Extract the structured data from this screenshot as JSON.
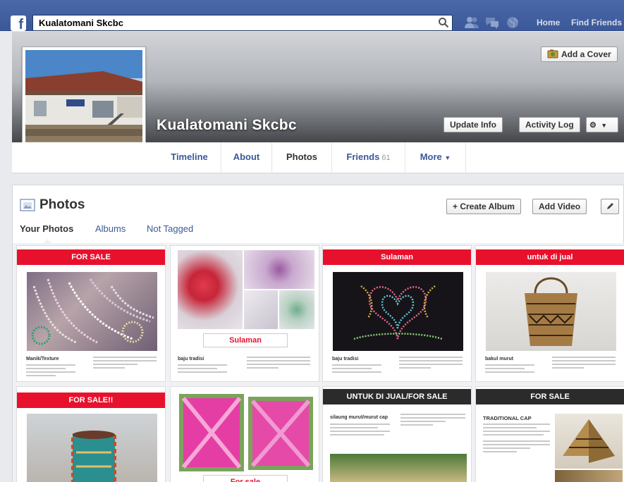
{
  "topbar": {
    "search_value": "Kualatomani Skcbc",
    "home_label": "Home",
    "find_friends_label": "Find Friends"
  },
  "cover": {
    "add_cover_label": "Add a Cover",
    "page_name": "Kualatomani Skcbc",
    "update_info_label": "Update Info",
    "activity_log_label": "Activity Log"
  },
  "nav": {
    "timeline": "Timeline",
    "about": "About",
    "photos": "Photos",
    "friends": "Friends",
    "friends_count": "61",
    "more": "More"
  },
  "photos": {
    "title": "Photos",
    "create_album_label": "+ Create Album",
    "add_video_label": "Add Video",
    "tabs": [
      "Your Photos",
      "Albums",
      "Not Tagged"
    ]
  },
  "tiles": {
    "t1": {
      "banner": "FOR SALE",
      "caption": "Manik/Texture"
    },
    "t2": {
      "label": "Sulaman",
      "caption": "baju tradisi"
    },
    "t3": {
      "banner": "Sulaman",
      "caption": "baju tradisi"
    },
    "t4": {
      "banner": "untuk di jual",
      "caption": "bakul murut"
    },
    "t5": {
      "banner": "FOR SALE!!"
    },
    "t6": {
      "label": "For sale"
    },
    "t7": {
      "banner": "UNTUK DI JUAL/FOR SALE",
      "caption": "silaung murut/murut cap"
    },
    "t8": {
      "banner": "FOR SALE",
      "caption": "TRADITIONAL CAP"
    }
  },
  "colors": {
    "brand": "#3b5998",
    "banner_red": "#e8112d",
    "banner_dark": "#2b2b2b"
  }
}
